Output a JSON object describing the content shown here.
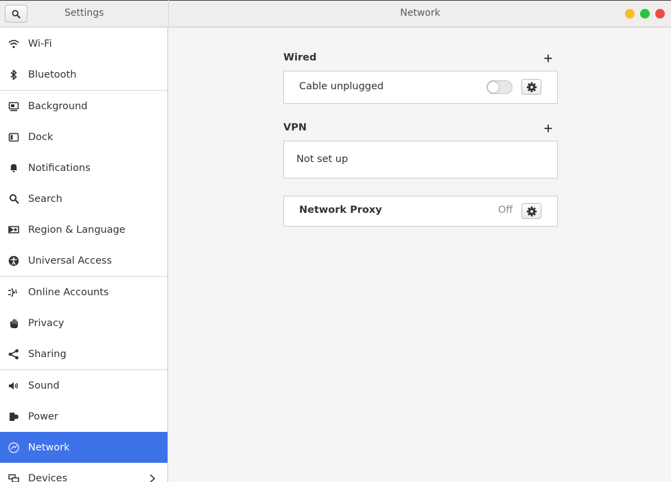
{
  "window": {
    "app_title": "Settings",
    "page_title": "Network"
  },
  "sidebar": {
    "items": [
      {
        "label": "Wi-Fi",
        "icon": "wifi-icon"
      },
      {
        "label": "Bluetooth",
        "icon": "bluetooth-icon"
      },
      {
        "label": "Background",
        "icon": "background-icon"
      },
      {
        "label": "Dock",
        "icon": "dock-icon"
      },
      {
        "label": "Notifications",
        "icon": "bell-icon"
      },
      {
        "label": "Search",
        "icon": "search-icon"
      },
      {
        "label": "Region & Language",
        "icon": "flag-icon"
      },
      {
        "label": "Universal Access",
        "icon": "accessibility-icon"
      },
      {
        "label": "Online Accounts",
        "icon": "online-accounts-icon"
      },
      {
        "label": "Privacy",
        "icon": "hand-icon"
      },
      {
        "label": "Sharing",
        "icon": "share-icon"
      },
      {
        "label": "Sound",
        "icon": "speaker-icon"
      },
      {
        "label": "Power",
        "icon": "power-plug-icon"
      },
      {
        "label": "Network",
        "icon": "network-icon",
        "active": true
      },
      {
        "label": "Devices",
        "icon": "devices-icon",
        "has_submenu": true
      }
    ]
  },
  "main": {
    "wired": {
      "title": "Wired",
      "status": "Cable unplugged",
      "toggle_on": false
    },
    "vpn": {
      "title": "VPN",
      "status": "Not set up"
    },
    "proxy": {
      "label": "Network Proxy",
      "value": "Off"
    }
  },
  "colors": {
    "accent": "#3d72e8",
    "window_close": "#ea4e43",
    "window_minimize": "#f4bf2a",
    "window_maximize": "#2bc43f"
  }
}
